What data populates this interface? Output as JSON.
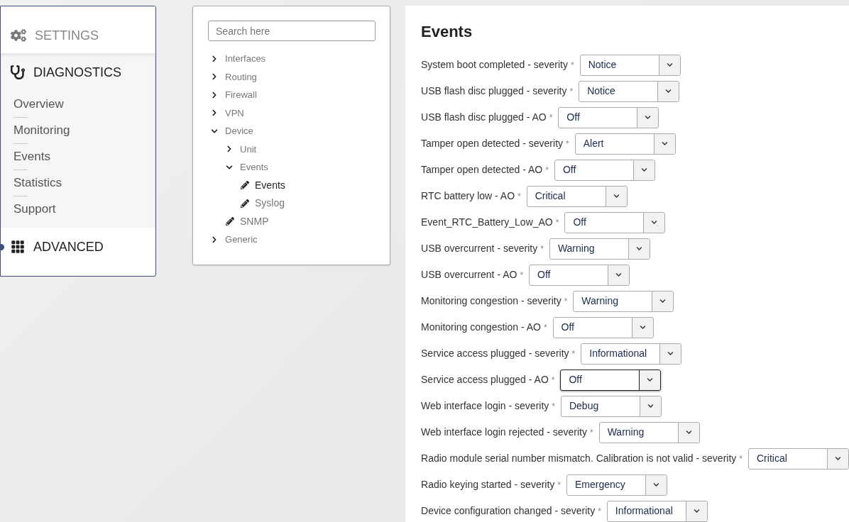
{
  "sidebar": {
    "sections": [
      {
        "label": "SETTINGS",
        "expanded": false,
        "marked": false
      },
      {
        "label": "DIAGNOSTICS",
        "expanded": true,
        "marked": false,
        "items": [
          "Overview",
          "Monitoring",
          "Events",
          "Statistics",
          "Support"
        ]
      },
      {
        "label": "ADVANCED",
        "expanded": false,
        "marked": true
      }
    ]
  },
  "tree": {
    "search": {
      "placeholder": "Search here"
    },
    "nodes": [
      {
        "label": "Interfaces",
        "kind": "folder",
        "expanded": false
      },
      {
        "label": "Routing",
        "kind": "folder",
        "expanded": false
      },
      {
        "label": "Firewall",
        "kind": "folder",
        "expanded": false
      },
      {
        "label": "VPN",
        "kind": "folder",
        "expanded": false
      },
      {
        "label": "Device",
        "kind": "folder",
        "expanded": true,
        "children": [
          {
            "label": "Unit",
            "kind": "folder",
            "expanded": false
          },
          {
            "label": "Events",
            "kind": "folder",
            "expanded": true,
            "children": [
              {
                "label": "Events",
                "kind": "page",
                "selected": true
              },
              {
                "label": "Syslog",
                "kind": "page",
                "selected": false
              }
            ]
          },
          {
            "label": "SNMP",
            "kind": "page",
            "selected": false
          }
        ]
      },
      {
        "label": "Generic",
        "kind": "folder",
        "expanded": false
      }
    ]
  },
  "events": {
    "title": "Events",
    "fields": [
      {
        "label": "System boot completed - severity",
        "required": "*",
        "value": "Notice",
        "focused": false
      },
      {
        "label": "USB flash disc plugged - severity",
        "required": "*",
        "value": "Notice",
        "focused": false
      },
      {
        "label": "USB flash disc plugged - AO",
        "required": "*",
        "value": "Off",
        "focused": false
      },
      {
        "label": "Tamper open detected - severity",
        "required": "*",
        "value": "Alert",
        "focused": false
      },
      {
        "label": "Tamper open detected - AO",
        "required": "*",
        "value": "Off",
        "focused": false
      },
      {
        "label": "RTC battery low - AO",
        "required": "*",
        "value": "Critical",
        "focused": false
      },
      {
        "label": "Event_RTC_Battery_Low_AO",
        "required": "*",
        "value": "Off",
        "focused": false
      },
      {
        "label": "USB overcurrent - severity",
        "required": "*",
        "value": "Warning",
        "focused": false
      },
      {
        "label": "USB overcurrent - AO",
        "required": "*",
        "value": "Off",
        "focused": false
      },
      {
        "label": "Monitoring congestion - severity",
        "required": "*",
        "value": "Warning",
        "focused": false
      },
      {
        "label": "Monitoring congestion - AO",
        "required": "*",
        "value": "Off",
        "focused": false
      },
      {
        "label": "Service access plugged - severity",
        "required": "*",
        "value": "Informational",
        "focused": false
      },
      {
        "label": "Service access plugged - AO",
        "required": "*",
        "value": "Off",
        "focused": true
      },
      {
        "label": "Web interface login - severity",
        "required": "*",
        "value": "Debug",
        "focused": false
      },
      {
        "label": "Web interface login rejected - severity",
        "required": "*",
        "value": "Warning",
        "focused": false
      },
      {
        "label": "Radio module serial number mismatch. Calibration is not valid - severity",
        "required": "*",
        "value": "Critical",
        "focused": false
      },
      {
        "label": "Radio keying started - severity",
        "required": "*",
        "value": "Emergency",
        "focused": false
      },
      {
        "label": "Device configuration changed - severity",
        "required": "*",
        "value": "Informational",
        "focused": false
      }
    ]
  }
}
